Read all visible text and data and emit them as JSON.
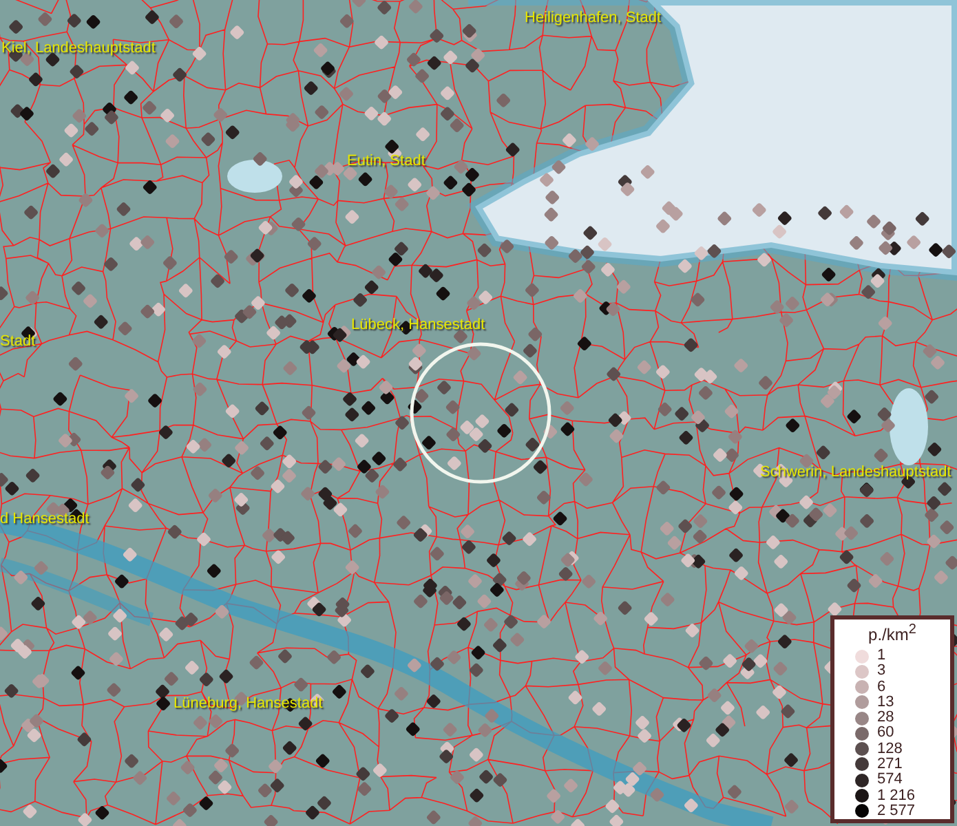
{
  "map": {
    "place_labels": [
      {
        "text": "Heiligenhafen, Stadt"
      },
      {
        "text": "Kiel, Landeshauptstadt"
      },
      {
        "text": "Eutin, Stadt"
      },
      {
        "text": "Stadt"
      },
      {
        "text": "Lübeck, Hansestadt"
      },
      {
        "text": "Schwerin, Landeshauptstadt"
      },
      {
        "text": "d Hansestadt"
      },
      {
        "text": "Lüneburg, Hansestadt"
      }
    ]
  },
  "legend": {
    "title": "p./km$^{2}$",
    "entries": [
      {
        "label": "1",
        "color": "#f0dcdc"
      },
      {
        "label": "3",
        "color": "#dcc6c6"
      },
      {
        "label": "6",
        "color": "#c8b2b2"
      },
      {
        "label": "13",
        "color": "#b09c9c"
      },
      {
        "label": "28",
        "color": "#988686"
      },
      {
        "label": "60",
        "color": "#7a6a6a"
      },
      {
        "label": "128",
        "color": "#5c5050"
      },
      {
        "label": "271",
        "color": "#443a3a"
      },
      {
        "label": "574",
        "color": "#2e2626"
      },
      {
        "label": "1 216",
        "color": "#1c1616"
      },
      {
        "label": "2 577",
        "color": "#060404"
      }
    ]
  }
}
